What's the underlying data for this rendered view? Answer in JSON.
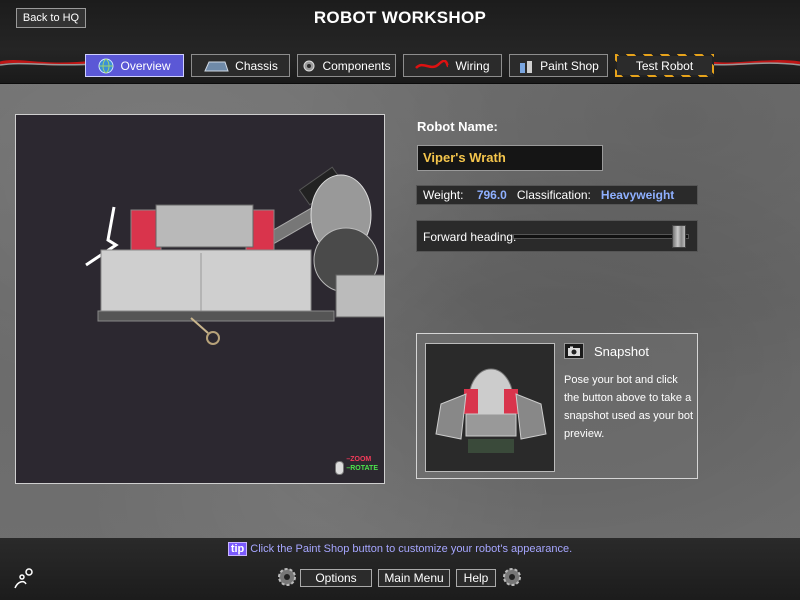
{
  "header": {
    "back_label": "Back to HQ",
    "title": "ROBOT WORKSHOP"
  },
  "tabs": [
    {
      "label": "Overview",
      "icon": "globe-icon",
      "active": true
    },
    {
      "label": "Chassis",
      "icon": "chassis-icon",
      "active": false
    },
    {
      "label": "Components",
      "icon": "gear-icon",
      "active": false
    },
    {
      "label": "Wiring",
      "icon": "wire-icon",
      "active": false
    },
    {
      "label": "Paint Shop",
      "icon": "paint-cans-icon",
      "active": false
    },
    {
      "label": "Test Robot",
      "icon": null,
      "active": false
    }
  ],
  "viewport": {
    "zoom_hint": "ZOOM",
    "rotate_hint": "ROTATE"
  },
  "robot": {
    "name_label": "Robot Name:",
    "name_value": "Viper's Wrath",
    "weight_label": "Weight:",
    "weight_value": "796.0",
    "class_label": "Classification:",
    "class_value": "Heavyweight",
    "heading_label": "Forward heading:",
    "heading_value": 0.98
  },
  "snapshot": {
    "title": "Snapshot",
    "description": "Pose your bot and click the button above to take a snapshot used as your bot preview."
  },
  "footer": {
    "tip_badge": "tip",
    "tip_text": "Click the Paint Shop button to customize your robot's appearance.",
    "options_label": "Options",
    "main_menu_label": "Main Menu",
    "help_label": "Help"
  },
  "colors": {
    "active_tab": "#5b58d6",
    "robot_name": "#f4c54c",
    "stat_value": "#8fb0ff",
    "tip_text": "#a6a6ff",
    "hazard": "#e7a31b"
  }
}
